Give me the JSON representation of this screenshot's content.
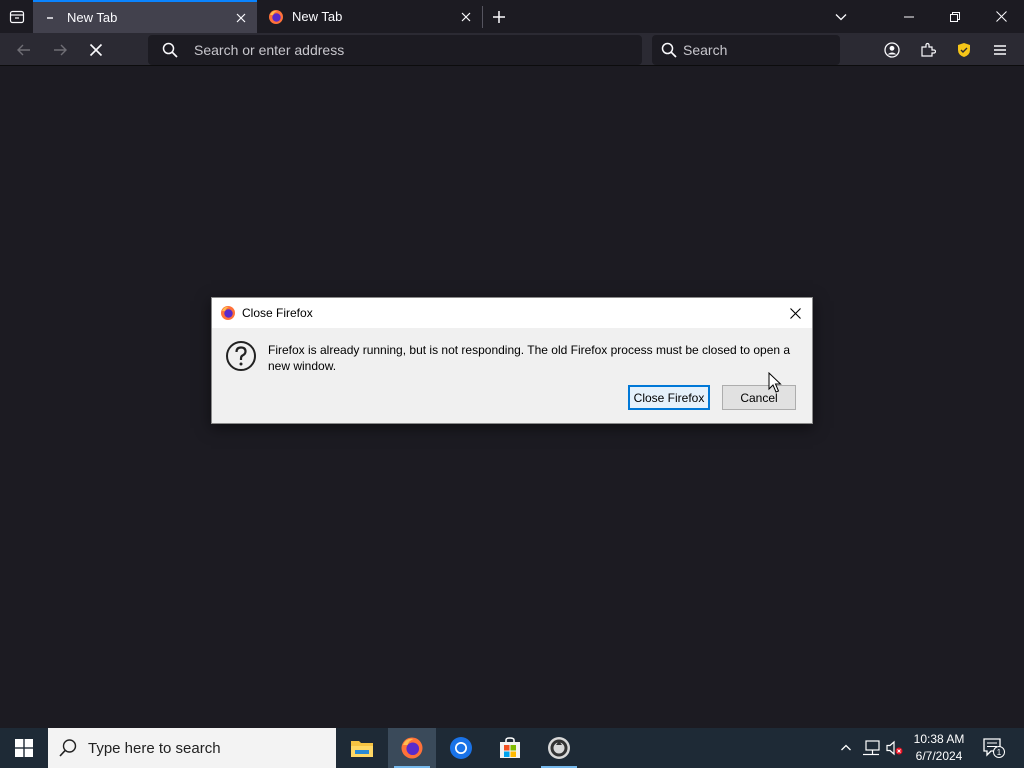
{
  "browser": {
    "tabs": [
      {
        "title": "New Tab",
        "active": true
      },
      {
        "title": "New Tab",
        "active": false
      }
    ],
    "urlbar": {
      "placeholder": "Search or enter address",
      "value": ""
    },
    "searchbar": {
      "placeholder": "Search",
      "value": ""
    }
  },
  "dialog": {
    "title": "Close Firefox",
    "message": "Firefox is already running, but is not responding. The old Firefox process must be closed to open a new window.",
    "primary_label": "Close Firefox",
    "cancel_label": "Cancel"
  },
  "taskbar": {
    "search_placeholder": "Type here to search",
    "apps": [
      "file-explorer",
      "firefox",
      "chrome",
      "microsoft-store",
      "app"
    ],
    "clock": {
      "time": "10:38 AM",
      "date": "6/7/2024"
    },
    "notification_count": "1"
  },
  "colors": {
    "page_bg": "#1c1b22",
    "toolbar_bg": "#2b2a33",
    "active_tab_bg": "#42414d",
    "accent": "#0a84ff",
    "taskbar_bg": "#1e2a36",
    "dialog_bg": "#f0f0f0"
  }
}
